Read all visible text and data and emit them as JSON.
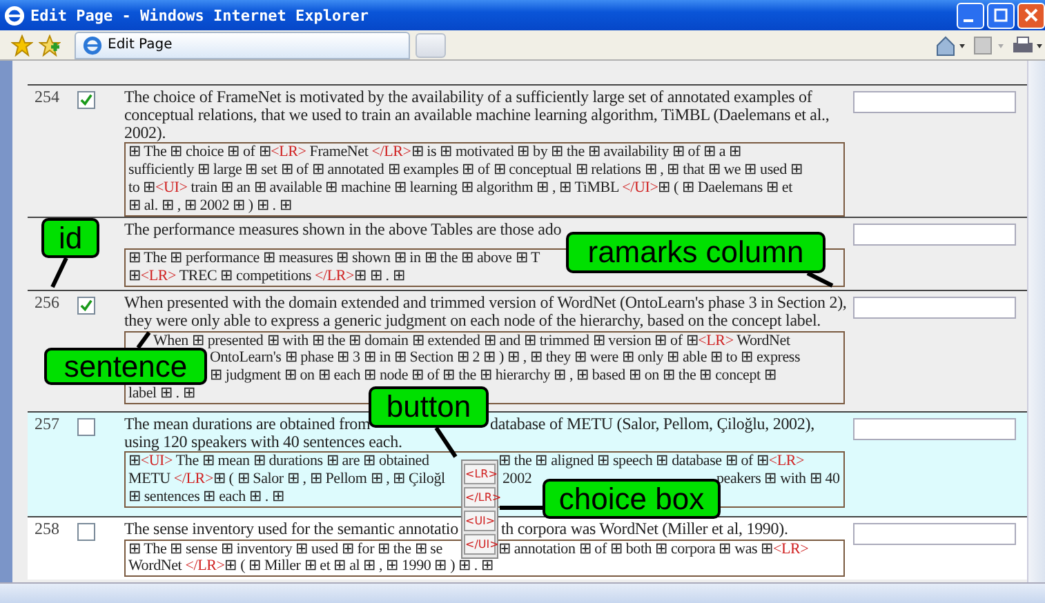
{
  "window": {
    "title": "Edit Page - Windows Internet Explorer"
  },
  "tab": {
    "label": "Edit Page"
  },
  "rows": [
    {
      "id": "254",
      "checked": true,
      "color": "#eeeeee",
      "sentence": [
        [
          "The choice of FrameNet is motivated by the availability of a sufficiently large set of annotated examples of"
        ],
        [
          "conceptual relations, that we used to train an available machine learning algorithm, TiMBL (Daelemans et al.,"
        ],
        [
          "2002)."
        ]
      ],
      "tagged": [
        [
          [
            {
              "text": "⊞ The ⊞ choice ⊞ of ⊞",
              "kind": "word"
            },
            {
              "text": "<LR>",
              "kind": "tag"
            },
            {
              "text": " FrameNet ",
              "kind": "word"
            },
            {
              "text": "</LR>",
              "kind": "tag"
            },
            {
              "text": "⊞ is ⊞ motivated ⊞ by ⊞ the ⊞ availability ⊞ of ⊞ a ⊞",
              "kind": "word"
            }
          ]
        ],
        [
          [
            {
              "text": "sufficiently ⊞ large ⊞ set ⊞ of ⊞ annotated ⊞ examples ⊞ of ⊞ conceptual ⊞ relations ⊞ , ⊞ that ⊞ we ⊞ used ⊞",
              "kind": "word"
            }
          ]
        ],
        [
          [
            {
              "text": "to ⊞",
              "kind": "word"
            },
            {
              "text": "<UI>",
              "kind": "tag"
            },
            {
              "text": " train ⊞ an ⊞ available ⊞ machine ⊞ learning ⊞ algorithm ⊞ , ⊞ TiMBL ",
              "kind": "word"
            },
            {
              "text": "</UI>",
              "kind": "tag"
            },
            {
              "text": "⊞ ( ⊞ Daelemans ⊞ et",
              "kind": "word"
            }
          ]
        ],
        [
          [
            {
              "text": "⊞ al. ⊞ , ⊞ 2002 ⊞ ) ⊞ . ⊞",
              "kind": "word"
            }
          ]
        ]
      ]
    },
    {
      "color": "#eeeeee",
      "sentence": [
        [
          "The performance measures shown in the above Tables are those ado"
        ]
      ],
      "tagged": [
        [
          [
            {
              "text": "⊞ The ⊞ performance ⊞ measures ⊞ shown ⊞ in ⊞ the ⊞ above ⊞ T",
              "kind": "word"
            }
          ]
        ],
        [
          [
            {
              "text": "⊞",
              "kind": "word"
            },
            {
              "text": "<LR>",
              "kind": "tag"
            },
            {
              "text": " TREC ⊞ competitions ",
              "kind": "word"
            },
            {
              "text": "</LR>",
              "kind": "tag"
            },
            {
              "text": "⊞ ⊞ . ⊞",
              "kind": "word"
            }
          ]
        ]
      ]
    },
    {
      "id": "256",
      "checked": true,
      "color": "#eeeeee",
      "sentence": [
        [
          "When presented with the domain extended and trimmed version of WordNet (OntoLearn's phase 3 in Section 2),"
        ],
        [
          "they were only able to express a generic judgment on each node of the hierarchy, based on the concept label."
        ]
      ],
      "tagged": [
        [
          [
            {
              "text": "When ⊞ presented ⊞ with ⊞ the ⊞ domain ⊞ extended ⊞ and ⊞ trimmed ⊞ version ⊞ of ⊞",
              "kind": "word"
            },
            {
              "text": "<LR>",
              "kind": "tag"
            },
            {
              "text": " WordNet",
              "kind": "word"
            }
          ]
        ],
        [
          [
            {
              "text": "OntoLearn's ⊞ phase ⊞ 3 ⊞ in ⊞ Section ⊞ 2 ⊞ ) ⊞ , ⊞ they ⊞ were ⊞ only ⊞ able ⊞ to ⊞ express",
              "kind": "word"
            }
          ]
        ],
        [
          [
            {
              "text": "⊞ judgment ⊞ on ⊞ each ⊞ node ⊞ of ⊞ the ⊞ hierarchy ⊞ , ⊞ based ⊞ on ⊞ the ⊞ concept ⊞",
              "kind": "word"
            }
          ]
        ],
        [
          [
            {
              "text": "label ⊞ . ⊞",
              "kind": "word"
            }
          ]
        ]
      ]
    },
    {
      "id": "257",
      "checked": false,
      "color": "#ddfbfd",
      "sentence": [
        [
          "The mean durations are obtained from",
          "database of METU (Salor, Pellom, Çiloğlu, 2002),"
        ],
        [
          "using 120 speakers with 40 sentences each."
        ]
      ],
      "tagged": [
        [
          [
            {
              "text": "⊞",
              "kind": "word"
            },
            {
              "text": "<UI>",
              "kind": "tag"
            },
            {
              "text": " The ⊞ mean ⊞ durations ⊞ are ⊞ obtained",
              "kind": "word"
            }
          ],
          [
            {
              "text": "⊞ the ⊞ aligned ⊞ speech ⊞ database ⊞ of ⊞",
              "kind": "word"
            },
            {
              "text": "<LR>",
              "kind": "tag"
            }
          ]
        ],
        [
          [
            {
              "text": "METU ",
              "kind": "word"
            },
            {
              "text": "</LR>",
              "kind": "tag"
            },
            {
              "text": "⊞ ( ⊞ Salor ⊞ , ⊞ Pellom ⊞ , ⊞ Çiloğl",
              "kind": "word"
            }
          ],
          [
            {
              "text": "2002",
              "kind": "word"
            }
          ],
          [
            {
              "text": "peakers ⊞ with ⊞ 40",
              "kind": "word"
            }
          ]
        ],
        [
          [
            {
              "text": "⊞ sentences ⊞ each ⊞ . ⊞",
              "kind": "word"
            }
          ]
        ]
      ]
    },
    {
      "id": "258",
      "checked": false,
      "color": "#ffffff",
      "sentence": [
        [
          "The sense inventory used for the semantic annotatio",
          "th corpora was WordNet (Miller et al, 1990)."
        ]
      ],
      "tagged": [
        [
          [
            {
              "text": "⊞ The ⊞ sense ⊞ inventory ⊞ used ⊞ for ⊞ the ⊞ se",
              "kind": "word"
            }
          ],
          [
            {
              "text": "⊞ annotation ⊞ of ⊞ both ⊞ corpora ⊞ was ⊞",
              "kind": "word"
            },
            {
              "text": "<LR>",
              "kind": "tag"
            }
          ]
        ],
        [
          [
            {
              "text": "WordNet ",
              "kind": "word"
            },
            {
              "text": "</LR>",
              "kind": "tag"
            },
            {
              "text": "⊞ ( ⊞ Miller ⊞ et ⊞ al ⊞ , ⊞ 1990 ⊞ ) ⊞ . ⊞",
              "kind": "word"
            }
          ]
        ]
      ]
    }
  ],
  "choice_box": [
    "<LR>",
    "</LR>",
    "<UI>",
    "</UI>"
  ],
  "callouts": [
    "id",
    "ramarks column",
    "sentence",
    "button",
    "choice box"
  ]
}
